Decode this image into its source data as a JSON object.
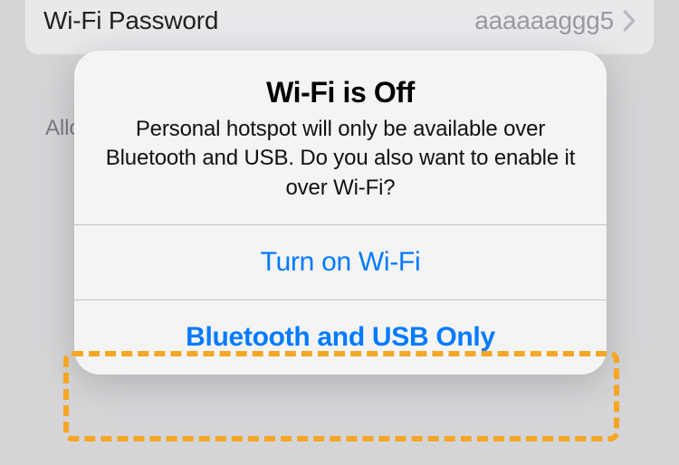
{
  "settings": {
    "wifiPassword": {
      "label": "Wi-Fi Password",
      "value": "aaaaaaggg5"
    },
    "description": "Allow\nto lo\nyou\nturn"
  },
  "descriptionFull": "Allow                                                                ud to lo                                                                  en you                                                                   u turn",
  "alert": {
    "title": "Wi-Fi is Off",
    "message": "Personal hotspot will only be available over Bluetooth and USB. Do you also want to enable it over Wi-Fi?",
    "primaryButton": "Turn on Wi-Fi",
    "secondaryButton": "Bluetooth and USB Only"
  }
}
